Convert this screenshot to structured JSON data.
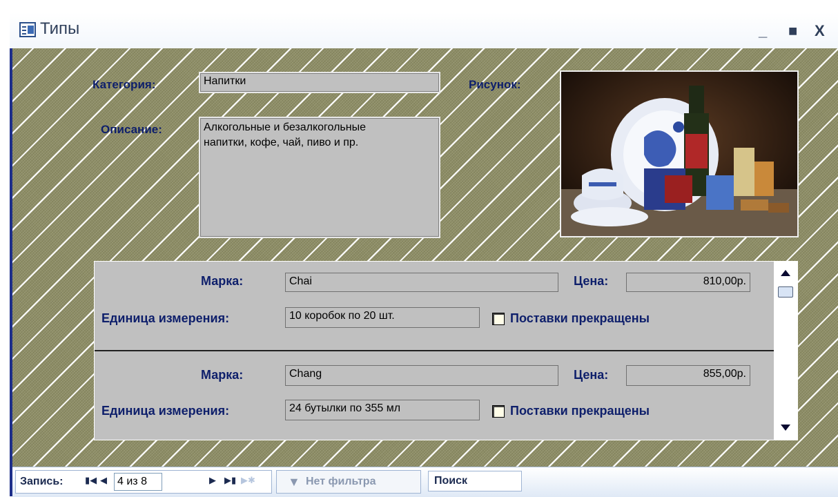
{
  "window": {
    "title": "Типы",
    "controls": {
      "minimize": "_",
      "maximize": "■",
      "close": "X"
    }
  },
  "form": {
    "category_label": "Категория:",
    "category_value": "Напитки",
    "description_label": "Описание:",
    "description_value": "Алкогольные и безалкогольные\nнапитки, кофе, чай, пиво и пр.",
    "picture_label": "Рисунок:"
  },
  "subform": {
    "records": [
      {
        "brand_label": "Марка:",
        "brand_value": "Chai",
        "price_label": "Цена:",
        "price_value": "810,00р.",
        "unit_label": "Единица измерения:",
        "unit_value": "10 коробок по 20 шт.",
        "discontinued_label": "Поставки прекращены",
        "discontinued": false
      },
      {
        "brand_label": "Марка:",
        "brand_value": "Chang",
        "price_label": "Цена:",
        "price_value": "855,00р.",
        "unit_label": "Единица измерения:",
        "unit_value": "24 бутылки по 355 мл",
        "discontinued_label": "Поставки прекращены",
        "discontinued": false
      }
    ]
  },
  "statusbar": {
    "record_label": "Запись:",
    "current_record": "4 из 8",
    "filter_text": "Нет фильтра",
    "search_text": "Поиск",
    "icons": {
      "first": "first-record-icon",
      "prev": "previous-record-icon",
      "next": "next-record-icon",
      "last": "last-record-icon",
      "new": "new-record-icon",
      "filter": "filter-icon"
    }
  }
}
